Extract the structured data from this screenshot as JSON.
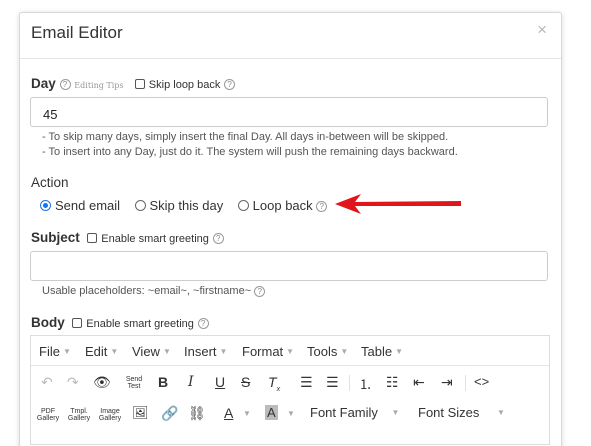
{
  "dialog": {
    "title": "Email Editor",
    "close_glyph": "×"
  },
  "day": {
    "label": "Day",
    "editing_tips": "Editing Tips",
    "skip_loop_back": "Skip loop back",
    "value": "45",
    "hint1": "- To skip many days, simply insert the final Day. All days in-between will be skipped.",
    "hint2": "- To insert into any Day, just do it. The system will push the remaining days backward."
  },
  "action": {
    "label": "Action",
    "options": [
      "Send email",
      "Skip this day",
      "Loop back"
    ],
    "selected": "Send email"
  },
  "subject": {
    "label": "Subject",
    "smart_greeting": "Enable smart greeting",
    "value": "",
    "placeholders": "Usable placeholders: ~email~, ~firstname~"
  },
  "body": {
    "label": "Body",
    "smart_greeting": "Enable smart greeting"
  },
  "editor": {
    "menus": [
      "File",
      "Edit",
      "View",
      "Insert",
      "Format",
      "Tools",
      "Table"
    ],
    "send_test": [
      "Send",
      "Test"
    ],
    "galleries": [
      [
        "PDF",
        "Gallery"
      ],
      [
        "Tmpl.",
        "Gallery"
      ],
      [
        "Image",
        "Gallery"
      ]
    ],
    "font_family": "Font Family",
    "font_sizes": "Font Sizes"
  },
  "colors": {
    "accent": "#1a73e8",
    "arrow": "#e0161c"
  }
}
